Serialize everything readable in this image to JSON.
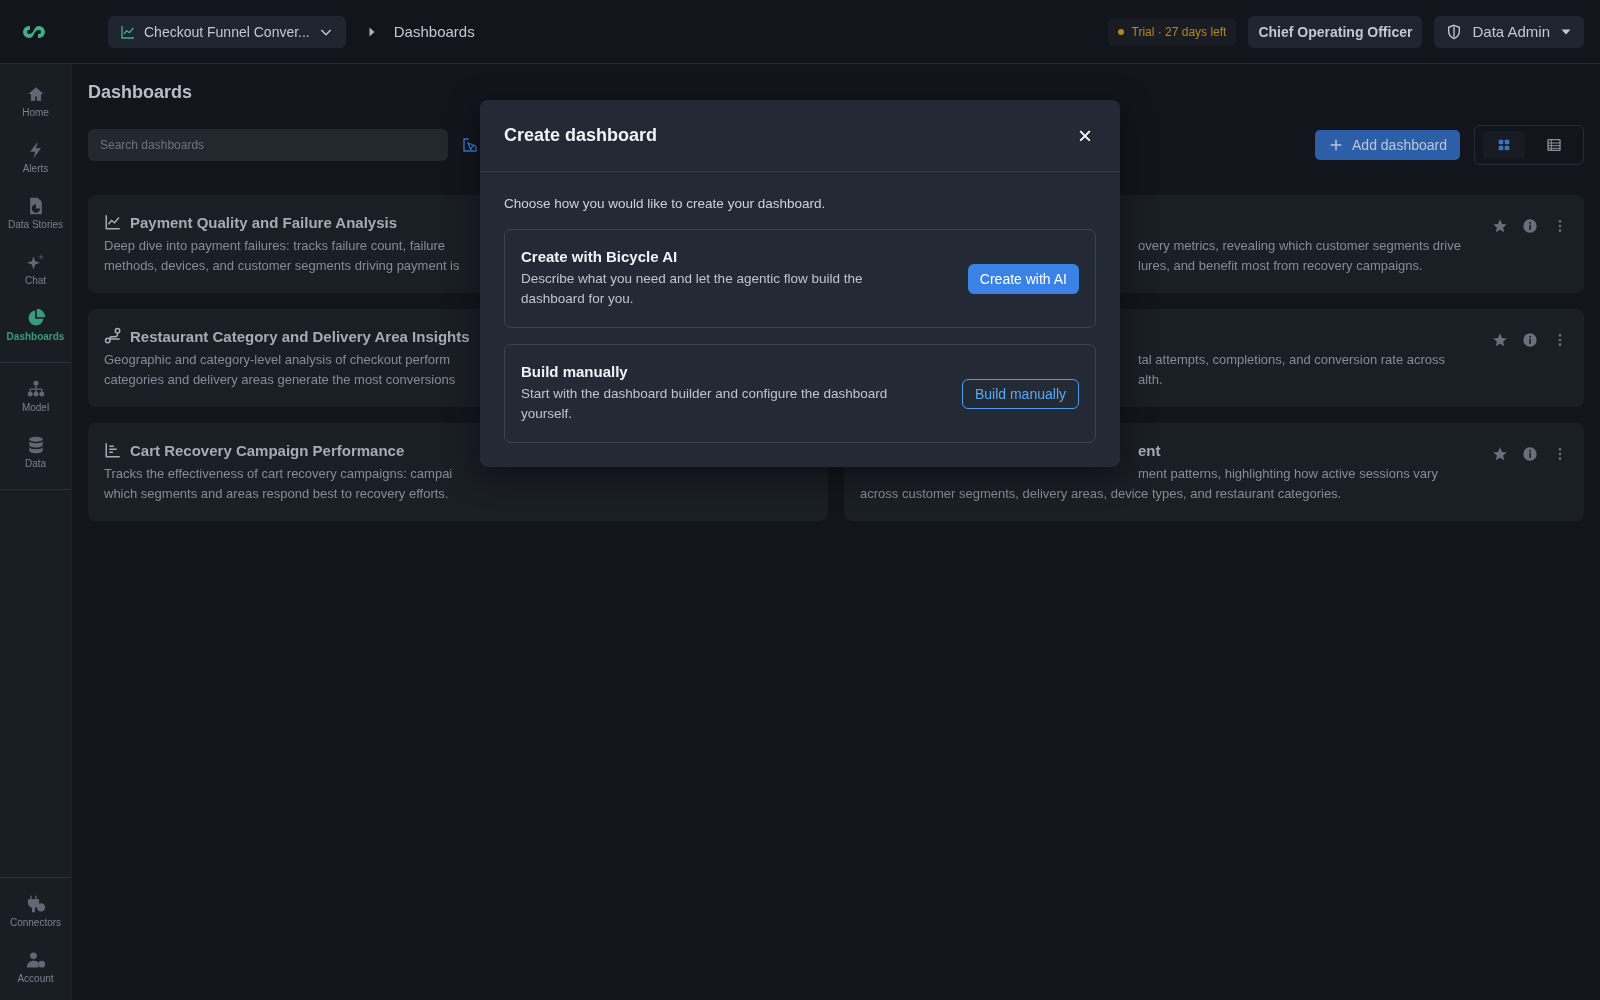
{
  "topbar": {
    "project": "Checkout Funnel Conver...",
    "breadcrumb": "Dashboards",
    "trial": "Trial · 27 days left",
    "role": "Chief Operating Officer",
    "user": "Data Admin"
  },
  "sidebar": {
    "items": [
      {
        "label": "Home",
        "selected": false
      },
      {
        "label": "Alerts",
        "selected": false
      },
      {
        "label": "Data Stories",
        "selected": false
      },
      {
        "label": "Chat",
        "selected": false
      },
      {
        "label": "Dashboards",
        "selected": true
      },
      {
        "label": "Model",
        "selected": false
      },
      {
        "label": "Data",
        "selected": false
      }
    ],
    "bottom": [
      {
        "label": "Connectors",
        "selected": false
      },
      {
        "label": "Account",
        "selected": false
      }
    ]
  },
  "page": {
    "title": "Dashboards",
    "search_placeholder": "Search dashboards",
    "add_button": "Add dashboard",
    "views": [
      {
        "selected": true
      },
      {
        "selected": false
      }
    ]
  },
  "cards": [
    {
      "title": "Payment Quality and Failure Analysis",
      "lines": [
        {
          "text": "Deep dive into payment failures: tracks failure count, failure",
          "kind": "full"
        },
        {
          "text": "methods, devices, and customer segments driving payment is",
          "kind": "full"
        }
      ]
    },
    {
      "lines": [
        {
          "text": "overy metrics, revealing which customer segments drive",
          "kind": "after-dialog"
        },
        {
          "text": "lures, and benefit most from recovery campaigns.",
          "kind": "after-dialog"
        }
      ]
    },
    {
      "title": "Restaurant Category and Delivery Area Insights",
      "lines": [
        {
          "text": "Geographic and category-level analysis of checkout perform",
          "kind": "full"
        },
        {
          "text": "categories and delivery areas generate the most conversions",
          "kind": "full"
        }
      ]
    },
    {
      "lines": [
        {
          "text": "tal attempts, completions, and conversion rate across",
          "kind": "after-dialog"
        },
        {
          "text": "alth.",
          "kind": "after-dialog"
        }
      ]
    },
    {
      "title": "Cart Recovery Campaign Performance",
      "lines": [
        {
          "text": "Tracks the effectiveness of cart recovery campaigns: campai",
          "kind": "full"
        },
        {
          "text": "which segments and areas respond best to recovery efforts.",
          "kind": "full"
        }
      ]
    },
    {
      "title": "ent",
      "lines": [
        {
          "text": "ment patterns, highlighting how active sessions vary",
          "kind": "after-dialog"
        },
        {
          "text": "across customer segments, delivery areas, device types, and restaurant categories.",
          "kind": "full"
        }
      ]
    }
  ],
  "dialog": {
    "title": "Create dashboard",
    "close": "×",
    "intro": "Choose how you would like to create your dashboard.",
    "options": [
      {
        "title": "Create with Bicycle AI",
        "description": "Describe what you need and let the agentic flow build the dashboard for you.",
        "button": "Create with AI",
        "kind": "primary"
      },
      {
        "title": "Build manually",
        "description": "Start with the dashboard builder and configure the dashboard yourself.",
        "button": "Build manually",
        "kind": "outline"
      }
    ]
  }
}
